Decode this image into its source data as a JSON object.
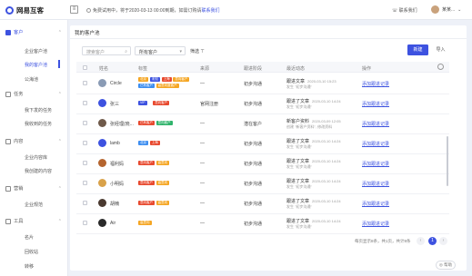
{
  "brand": {
    "name": "网易互客"
  },
  "topbar": {
    "collapse_icon": "☰",
    "notice_prefix": "免费试用中，将于2020-03-13 00:00到期，如需订购请",
    "notice_link": "联系我们",
    "contact": "联系我们",
    "user_name": "某某..."
  },
  "sidebar": {
    "groups": [
      {
        "label": "客户"
      },
      {
        "label": "任务"
      },
      {
        "label": "内容"
      },
      {
        "label": "营销"
      },
      {
        "label": "工具"
      }
    ],
    "items": [
      {
        "label": "企业客户池"
      },
      {
        "label": "我的客户池"
      },
      {
        "label": "公海池"
      },
      {
        "label": "我下发的任务"
      },
      {
        "label": "我收到的任务"
      },
      {
        "label": "企业内容库"
      },
      {
        "label": "我创建的内容"
      },
      {
        "label": "企业规范"
      },
      {
        "label": "名片"
      },
      {
        "label": "回收站"
      },
      {
        "label": "转移"
      }
    ]
  },
  "page": {
    "title": "我的客户池"
  },
  "filters": {
    "search_placeholder": "搜索客户",
    "range_label": "所有客户",
    "filter_label": "筛选",
    "new_button": "新建",
    "import_button": "导入"
  },
  "table": {
    "columns": [
      "姓名",
      "标签",
      "来源",
      "跟进阶段",
      "最近动态",
      "操作"
    ],
    "rows": [
      {
        "name": "Circle",
        "tags": [
          {
            "t": "北京",
            "c": "#f5a623"
          },
          {
            "t": "未知",
            "c": "#3d52e0"
          },
          {
            "t": "上海",
            "c": "#e8492e"
          },
          {
            "t": "意向客户",
            "c": "#f5a623"
          },
          {
            "t": "已有客户",
            "c": "#3d8ef0"
          },
          {
            "t": "高意向度客户",
            "c": "#f5a623"
          }
        ],
        "source": "—",
        "stage": "初步沟通",
        "fu_title": "跟进文章",
        "fu_time": "2020-03-10 15:23",
        "fu_sub": "发生 \"初步沟通\"",
        "op": "添加跟进记录",
        "avatar": "#8a9bb5"
      },
      {
        "name": "张三",
        "tags": [
          {
            "t": "VIP",
            "c": "#3d52e0"
          },
          {
            "t": "意向客户",
            "c": "#e8492e"
          }
        ],
        "source": "官网注册",
        "stage": "初步沟通",
        "fu_title": "跟进了文章",
        "fu_time": "2020-03-10 14:24",
        "fu_sub": "发生 \"初步沟通\"",
        "op": "添加跟进记录",
        "avatar": "#3d52e0"
      },
      {
        "name": "张经理(晓...",
        "tags": [
          {
            "t": "已有客户",
            "c": "#e8492e"
          },
          {
            "t": "意向客户",
            "c": "#2fb36b"
          }
        ],
        "source": "—",
        "stage": "潜在客户",
        "fu_title": "新客户资料",
        "fu_time": "2020-03-09 12:05",
        "fu_sub": "创建 \"新客户资料\", 修改资料",
        "op": "添加跟进记录",
        "avatar": "#6f5a4a"
      },
      {
        "name": "lamb",
        "tags": [
          {
            "t": "北京",
            "c": "#3d8ef0"
          },
          {
            "t": "上海",
            "c": "#e8492e"
          }
        ],
        "source": "—",
        "stage": "初步沟通",
        "fu_title": "跟进了文章",
        "fu_time": "2020-03-10 14:24",
        "fu_sub": "发生 \"初步沟通\"",
        "op": "添加跟进记录",
        "avatar": "#3d52e0"
      },
      {
        "name": "福利妈",
        "tags": [
          {
            "t": "意向客户",
            "c": "#e8492e"
          },
          {
            "t": "高意向",
            "c": "#f5a623"
          }
        ],
        "source": "—",
        "stage": "初步沟通",
        "fu_title": "跟进了文章",
        "fu_time": "2020-03-10 14:24",
        "fu_sub": "发生 \"初步沟通\"",
        "op": "添加跟进记录",
        "avatar": "#b5652f"
      },
      {
        "name": "小明妈",
        "tags": [
          {
            "t": "意向客户",
            "c": "#e8492e"
          },
          {
            "t": "高意向",
            "c": "#f5a623"
          }
        ],
        "source": "—",
        "stage": "初步沟通",
        "fu_title": "跟进了文章",
        "fu_time": "2020-03-10 14:24",
        "fu_sub": "发生 \"初步沟通\"",
        "op": "添加跟进记录",
        "avatar": "#d9a24a"
      },
      {
        "name": "胡楠",
        "tags": [
          {
            "t": "意向客户",
            "c": "#e8492e"
          },
          {
            "t": "高意向",
            "c": "#f5a623"
          }
        ],
        "source": "—",
        "stage": "初步沟通",
        "fu_title": "跟进了文章",
        "fu_time": "2020-03-10 14:24",
        "fu_sub": "发生 \"初步沟通\"",
        "op": "添加跟进记录",
        "avatar": "#4a3a30"
      },
      {
        "name": "Air",
        "tags": [
          {
            "t": "高意向",
            "c": "#f5a623"
          }
        ],
        "source": "—",
        "stage": "初步沟通",
        "fu_title": "跟进了文章",
        "fu_time": "2020-03-10 14:24",
        "fu_sub": "发生 \"初步沟通\"",
        "op": "添加跟进记录",
        "avatar": "#2a2a2a"
      }
    ]
  },
  "pagination": {
    "summary": "每页显示8条，共1页，共计8条",
    "prev": "‹",
    "current": "1",
    "next": "›"
  },
  "help": {
    "label": "帮助"
  }
}
